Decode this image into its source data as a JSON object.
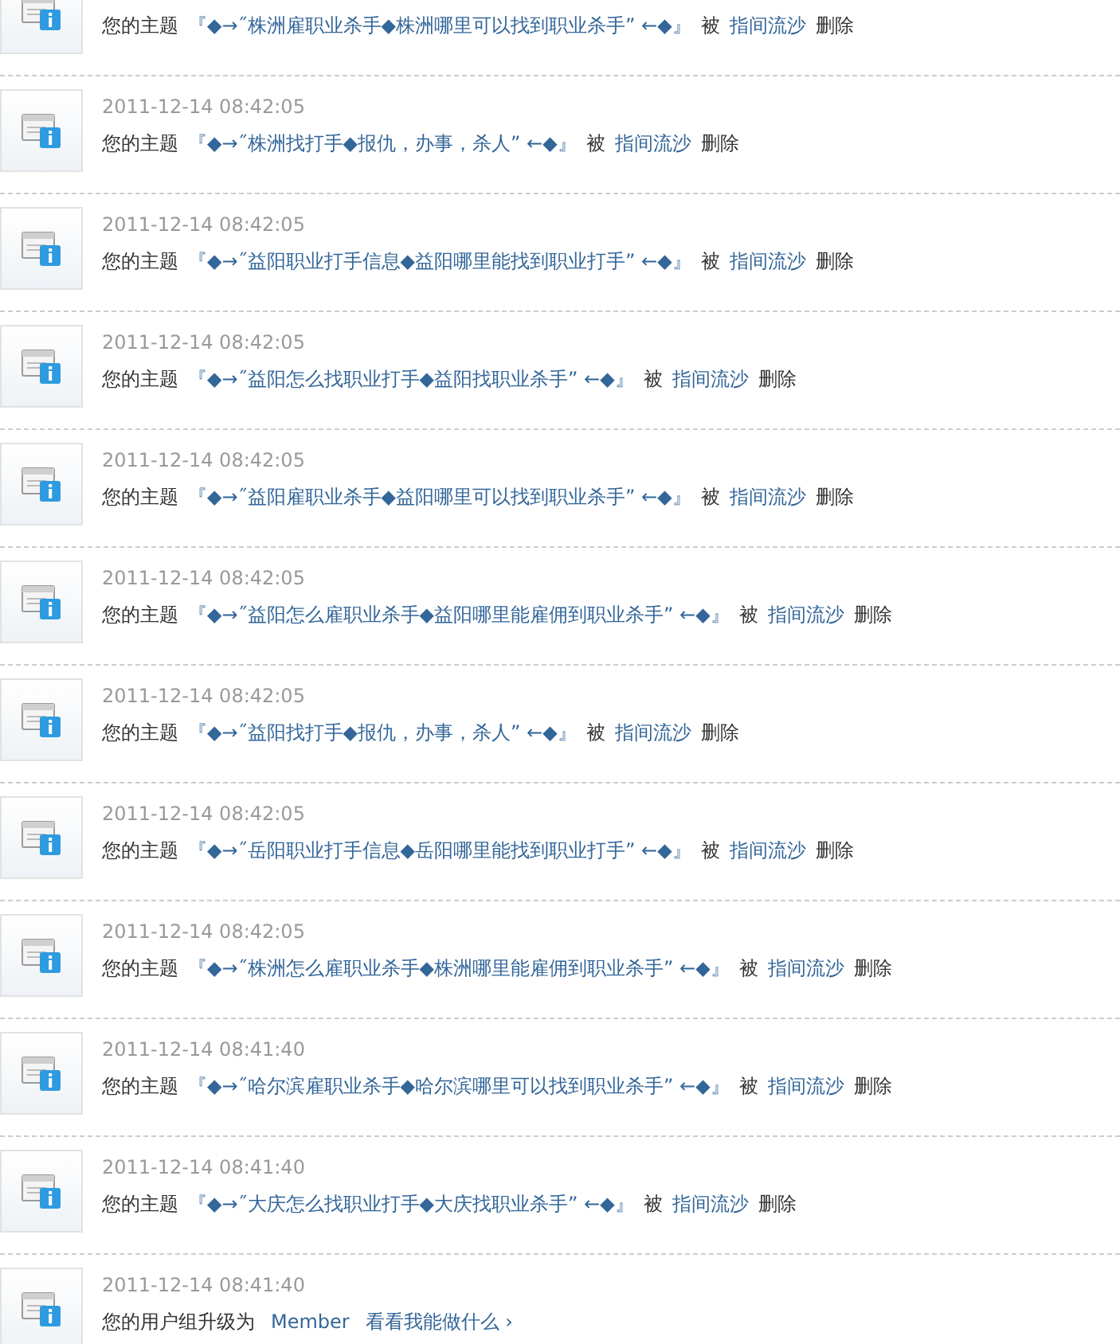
{
  "notices": [
    {
      "kind": "topic",
      "prefix": "您的主题",
      "topic": "『◆→˝株洲雇职业杀手◆株洲哪里可以找到职业杀手” ←◆』",
      "by": "被",
      "user": "指间流沙",
      "action": "删除"
    },
    {
      "kind": "topic",
      "time": "2011-12-14 08:42:05",
      "prefix": "您的主题",
      "topic": "『◆→˝株洲找打手◆报仇，办事，杀人” ←◆』",
      "by": "被",
      "user": "指间流沙",
      "action": "删除"
    },
    {
      "kind": "topic",
      "time": "2011-12-14 08:42:05",
      "prefix": "您的主题",
      "topic": "『◆→˝益阳职业打手信息◆益阳哪里能找到职业打手” ←◆』",
      "by": "被",
      "user": "指间流沙",
      "action": "删除"
    },
    {
      "kind": "topic",
      "time": "2011-12-14 08:42:05",
      "prefix": "您的主题",
      "topic": "『◆→˝益阳怎么找职业打手◆益阳找职业杀手” ←◆』",
      "by": "被",
      "user": "指间流沙",
      "action": "删除"
    },
    {
      "kind": "topic",
      "time": "2011-12-14 08:42:05",
      "prefix": "您的主题",
      "topic": "『◆→˝益阳雇职业杀手◆益阳哪里可以找到职业杀手” ←◆』",
      "by": "被",
      "user": "指间流沙",
      "action": "删除"
    },
    {
      "kind": "topic",
      "time": "2011-12-14 08:42:05",
      "prefix": "您的主题",
      "topic": "『◆→˝益阳怎么雇职业杀手◆益阳哪里能雇佣到职业杀手” ←◆』",
      "by": "被",
      "user": "指间流沙",
      "action": "删除"
    },
    {
      "kind": "topic",
      "time": "2011-12-14 08:42:05",
      "prefix": "您的主题",
      "topic": "『◆→˝益阳找打手◆报仇，办事，杀人” ←◆』",
      "by": "被",
      "user": "指间流沙",
      "action": "删除"
    },
    {
      "kind": "topic",
      "time": "2011-12-14 08:42:05",
      "prefix": "您的主题",
      "topic": "『◆→˝岳阳职业打手信息◆岳阳哪里能找到职业打手” ←◆』",
      "by": "被",
      "user": "指间流沙",
      "action": "删除"
    },
    {
      "kind": "topic",
      "time": "2011-12-14 08:42:05",
      "prefix": "您的主题",
      "topic": "『◆→˝株洲怎么雇职业杀手◆株洲哪里能雇佣到职业杀手” ←◆』",
      "by": "被",
      "user": "指间流沙",
      "action": "删除"
    },
    {
      "kind": "topic",
      "time": "2011-12-14 08:41:40",
      "prefix": "您的主题",
      "topic": "『◆→˝哈尔滨雇职业杀手◆哈尔滨哪里可以找到职业杀手” ←◆』",
      "by": "被",
      "user": "指间流沙",
      "action": "删除"
    },
    {
      "kind": "topic",
      "time": "2011-12-14 08:41:40",
      "prefix": "您的主题",
      "topic": "『◆→˝大庆怎么找职业打手◆大庆找职业杀手” ←◆』",
      "by": "被",
      "user": "指间流沙",
      "action": "删除"
    },
    {
      "kind": "group",
      "time": "2011-12-14 08:41:40",
      "prefix": "您的用户组升级为",
      "group": "Member",
      "link": "看看我能做什么 ›"
    }
  ]
}
